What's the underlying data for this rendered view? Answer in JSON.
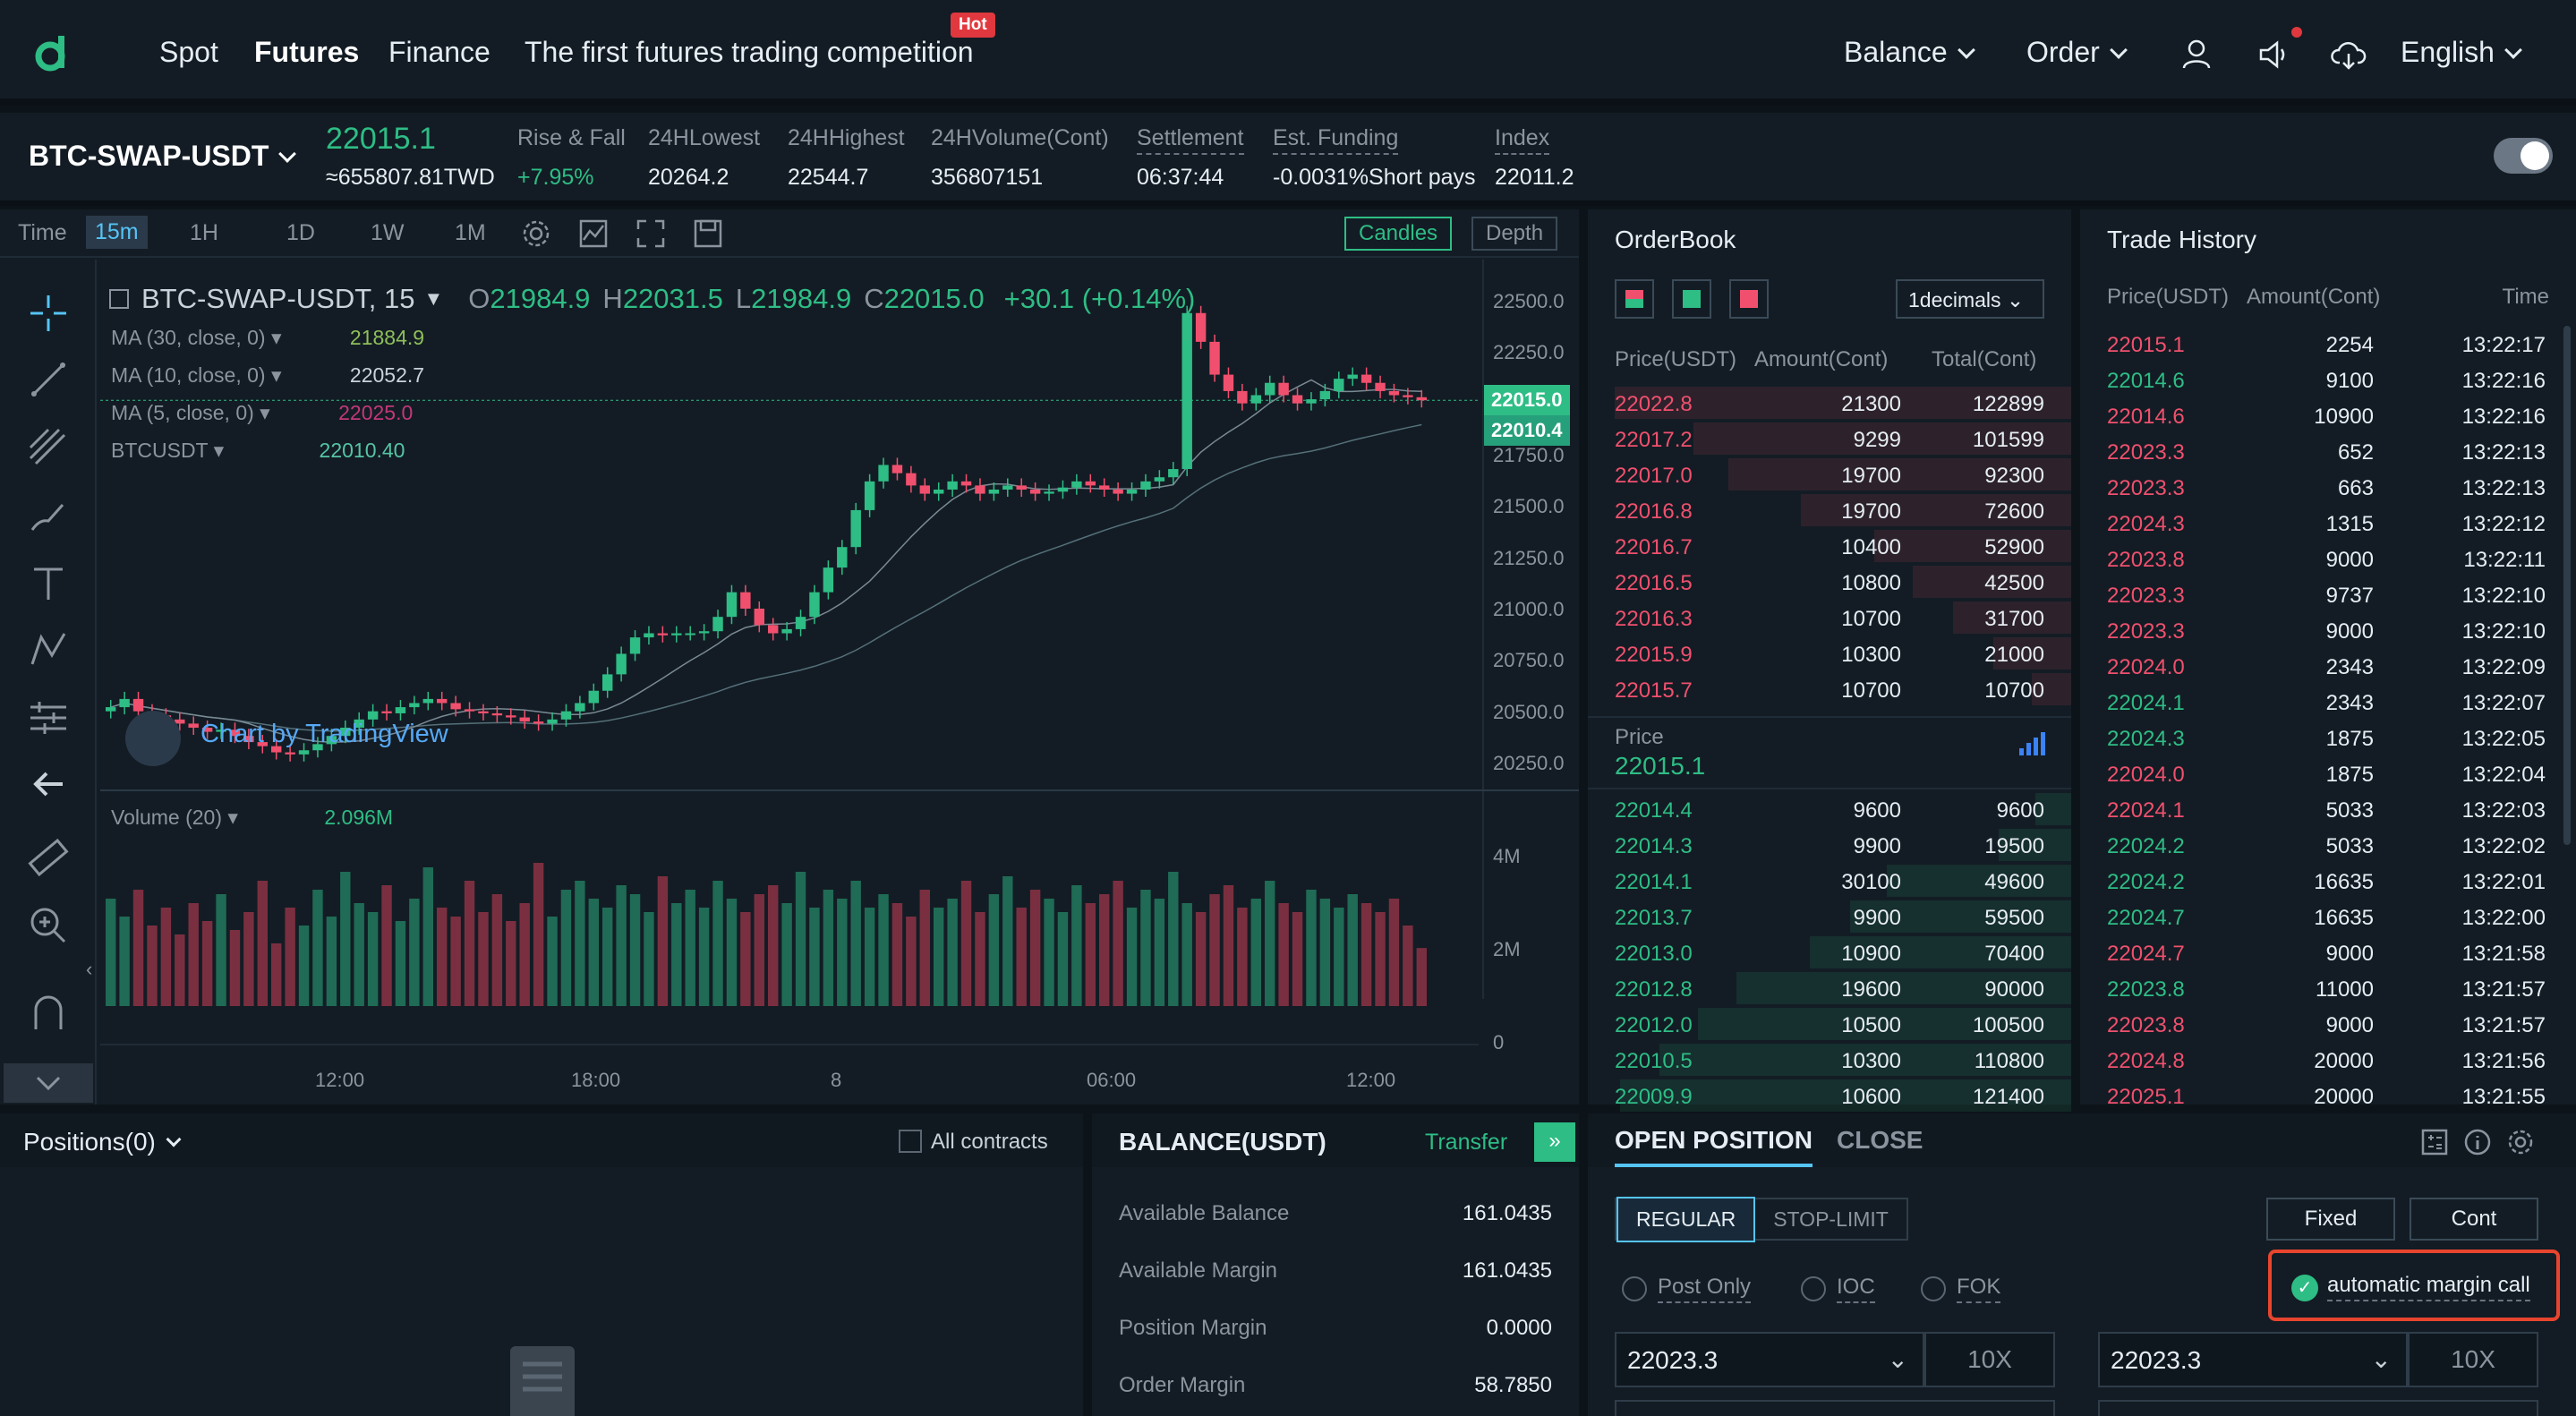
{
  "nav": {
    "items": [
      "Spot",
      "Futures",
      "Finance",
      "The first futures trading competition"
    ],
    "hot_badge": "Hot",
    "right": [
      "Balance",
      "Order",
      "English"
    ]
  },
  "ticker": {
    "pair": "BTC-SWAP-USDT",
    "last_price": "22015.1",
    "twd_price": "≈655807.81TWD",
    "stats": [
      {
        "label": "Rise & Fall",
        "value": "+7.95%"
      },
      {
        "label": "24HLowest",
        "value": "20264.2"
      },
      {
        "label": "24HHighest",
        "value": "22544.7"
      },
      {
        "label": "24HVolume(Cont)",
        "value": "356807151"
      },
      {
        "label": "Settlement",
        "value": "06:37:44"
      },
      {
        "label": "Est. Funding",
        "value": "-0.0031%Short pays"
      },
      {
        "label": "Index",
        "value": "22011.2"
      }
    ]
  },
  "chart_toolbar": {
    "time_label": "Time",
    "intervals": [
      "15m",
      "1H",
      "1D",
      "1W",
      "1M"
    ],
    "candles_label": "Candles",
    "depth_label": "Depth"
  },
  "chart_legend": {
    "symbol": "BTC-SWAP-USDT, 15",
    "ohlc": {
      "o": "21984.9",
      "h": "22031.5",
      "l": "21984.9",
      "c": "22015.0",
      "chg": "+30.1 (+0.14%)"
    },
    "indicators": [
      {
        "name": "MA (30, close, 0)",
        "value": "21884.9"
      },
      {
        "name": "MA (10, close, 0)",
        "value": "22052.7"
      },
      {
        "name": "MA (5, close, 0)",
        "value": "22025.0"
      },
      {
        "name": "BTCUSDT",
        "value": "22010.40"
      }
    ],
    "watermark": "Chart by TradingView",
    "volume_name": "Volume (20)",
    "volume_value": "2.096M"
  },
  "chart_data": {
    "type": "candlestick",
    "y_ticks": [
      "22500.0",
      "22250.0",
      "22000.0",
      "21750.0",
      "21500.0",
      "21250.0",
      "21000.0",
      "20750.0",
      "20500.0",
      "20250.0"
    ],
    "price_tags": [
      "22015.0",
      "22010.4"
    ],
    "vol_ticks": [
      "4M",
      "2M",
      "0"
    ],
    "x_ticks": [
      "12:00",
      "18:00",
      "8",
      "06:00",
      "12:00"
    ],
    "close_series": [
      20520,
      20560,
      20500,
      20480,
      20460,
      20440,
      20420,
      20400,
      20410,
      20380,
      20350,
      20330,
      20300,
      20290,
      20310,
      20340,
      20380,
      20420,
      20460,
      20500,
      20490,
      20520,
      20540,
      20560,
      20540,
      20510,
      20500,
      20490,
      20480,
      20470,
      20450,
      20440,
      20460,
      20500,
      20540,
      20600,
      20680,
      20780,
      20860,
      20880,
      20870,
      20880,
      20880,
      20890,
      20960,
      21080,
      21000,
      20920,
      20880,
      20900,
      20960,
      21080,
      21200,
      21300,
      21480,
      21620,
      21700,
      21660,
      21600,
      21560,
      21580,
      21620,
      21600,
      21560,
      21580,
      21600,
      21580,
      21560,
      21570,
      21590,
      21620,
      21600,
      21580,
      21560,
      21580,
      21620,
      21640,
      21680,
      22440,
      22300,
      22140,
      22060,
      22000,
      22040,
      22100,
      22040,
      22000,
      22020,
      22060,
      22120,
      22140,
      22100,
      22060,
      22040,
      22030,
      22015
    ],
    "volume_series": [
      3.2,
      2.8,
      3.4,
      2.6,
      3.0,
      2.4,
      3.1,
      2.7,
      3.3,
      2.5,
      2.9,
      3.6,
      2.2,
      3.0,
      2.6,
      3.4,
      2.8,
      3.8,
      3.1,
      2.9,
      3.5,
      2.7,
      3.2,
      3.9,
      3.0,
      2.8,
      3.6,
      2.9,
      3.3,
      2.7,
      3.1,
      4.0,
      2.8,
      3.4,
      3.6,
      3.2,
      3.0,
      3.5,
      3.3,
      2.9,
      3.7,
      3.1,
      3.4,
      3.0,
      3.6,
      3.2,
      2.9,
      3.3,
      3.5,
      3.1,
      3.8,
      3.0,
      3.4,
      3.2,
      3.6,
      3.0,
      3.3,
      3.1,
      2.8,
      3.4,
      3.0,
      3.2,
      3.6,
      2.9,
      3.3,
      3.7,
      3.0,
      3.4,
      3.2,
      2.9,
      3.5,
      3.1,
      3.3,
      3.6,
      3.0,
      3.4,
      3.2,
      3.8,
      3.1,
      2.9,
      3.3,
      3.5,
      3.0,
      3.2,
      3.6,
      3.1,
      2.9,
      3.4,
      3.2,
      3.0,
      3.3,
      3.1,
      2.9,
      3.2,
      2.6,
      2.096
    ]
  },
  "orderbook": {
    "title": "OrderBook",
    "decimals": "1decimals",
    "cols": [
      "Price(USDT)",
      "Amount(Cont)",
      "Total(Cont)"
    ],
    "asks": [
      [
        "22022.8",
        "21300",
        "122899"
      ],
      [
        "22017.2",
        "9299",
        "101599"
      ],
      [
        "22017.0",
        "19700",
        "92300"
      ],
      [
        "22016.8",
        "19700",
        "72600"
      ],
      [
        "22016.7",
        "10400",
        "52900"
      ],
      [
        "22016.5",
        "10800",
        "42500"
      ],
      [
        "22016.3",
        "10700",
        "31700"
      ],
      [
        "22015.9",
        "10300",
        "21000"
      ],
      [
        "22015.7",
        "10700",
        "10700"
      ]
    ],
    "price_label": "Price",
    "price_value": "22015.1",
    "bids": [
      [
        "22014.4",
        "9600",
        "9600"
      ],
      [
        "22014.3",
        "9900",
        "19500"
      ],
      [
        "22014.1",
        "30100",
        "49600"
      ],
      [
        "22013.7",
        "9900",
        "59500"
      ],
      [
        "22013.0",
        "10900",
        "70400"
      ],
      [
        "22012.8",
        "19600",
        "90000"
      ],
      [
        "22012.0",
        "10500",
        "100500"
      ],
      [
        "22010.5",
        "10300",
        "110800"
      ],
      [
        "22009.9",
        "10600",
        "121400"
      ]
    ]
  },
  "trades": {
    "title": "Trade History",
    "cols": [
      "Price(USDT)",
      "Amount(Cont)",
      "Time"
    ],
    "rows": [
      [
        "22015.1",
        "2254",
        "13:22:17",
        "red"
      ],
      [
        "22014.6",
        "9100",
        "13:22:16",
        "green"
      ],
      [
        "22014.6",
        "10900",
        "13:22:16",
        "red"
      ],
      [
        "22023.3",
        "652",
        "13:22:13",
        "red"
      ],
      [
        "22023.3",
        "663",
        "13:22:13",
        "red"
      ],
      [
        "22024.3",
        "1315",
        "13:22:12",
        "red"
      ],
      [
        "22023.8",
        "9000",
        "13:22:11",
        "red"
      ],
      [
        "22023.3",
        "9737",
        "13:22:10",
        "red"
      ],
      [
        "22023.3",
        "9000",
        "13:22:10",
        "red"
      ],
      [
        "22024.0",
        "2343",
        "13:22:09",
        "red"
      ],
      [
        "22024.1",
        "2343",
        "13:22:07",
        "green"
      ],
      [
        "22024.3",
        "1875",
        "13:22:05",
        "green"
      ],
      [
        "22024.0",
        "1875",
        "13:22:04",
        "red"
      ],
      [
        "22024.1",
        "5033",
        "13:22:03",
        "red"
      ],
      [
        "22024.2",
        "5033",
        "13:22:02",
        "green"
      ],
      [
        "22024.2",
        "16635",
        "13:22:01",
        "green"
      ],
      [
        "22024.7",
        "16635",
        "13:22:00",
        "green"
      ],
      [
        "22024.7",
        "9000",
        "13:21:58",
        "red"
      ],
      [
        "22023.8",
        "11000",
        "13:21:57",
        "green"
      ],
      [
        "22023.8",
        "9000",
        "13:21:57",
        "red"
      ],
      [
        "22024.8",
        "20000",
        "13:21:56",
        "red"
      ],
      [
        "22025.1",
        "20000",
        "13:21:55",
        "red"
      ]
    ]
  },
  "positions": {
    "title": "Positions(0)",
    "all_contracts": "All contracts"
  },
  "balance": {
    "title": "BALANCE(USDT)",
    "transfer": "Transfer",
    "rows": [
      {
        "label": "Available Balance",
        "value": "161.0435"
      },
      {
        "label": "Available Margin",
        "value": "161.0435"
      },
      {
        "label": "Position Margin",
        "value": "0.0000"
      },
      {
        "label": "Order Margin",
        "value": "58.7850"
      }
    ]
  },
  "open_position": {
    "tabs": [
      "OPEN POSITION",
      "CLOSE"
    ],
    "order_types": [
      "REGULAR",
      "STOP-LIMIT"
    ],
    "modes": [
      "Fixed",
      "Cont"
    ],
    "options": [
      "Post Only",
      "IOC",
      "FOK"
    ],
    "auto_margin": "automatic margin call",
    "buy_price": "22023.3",
    "buy_leverage": "10X",
    "sell_price": "22023.3",
    "sell_leverage": "10X"
  },
  "colors": {
    "up": "#2ebd85",
    "down": "#f0506e",
    "accent": "#56c4f5",
    "highlight": "#e8452e"
  }
}
